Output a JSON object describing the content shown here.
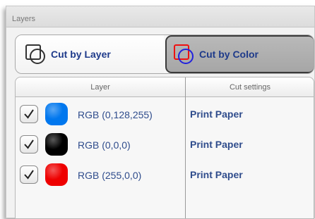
{
  "panel": {
    "title": "Layers"
  },
  "modes": {
    "cut_by_layer": "Cut by Layer",
    "cut_by_color": "Cut by Color",
    "selected": "Cut by Color"
  },
  "table": {
    "columns": [
      "Layer",
      "Cut settings"
    ],
    "rows": [
      {
        "checked": true,
        "color": "#0077ee",
        "color_label": "RGB (0,128,255)",
        "cut_setting": "Print Paper"
      },
      {
        "checked": true,
        "color": "#000000",
        "color_label": "RGB (0,0,0)",
        "cut_setting": "Print Paper"
      },
      {
        "checked": true,
        "color": "#ee0000",
        "color_label": "RGB (255,0,0)",
        "cut_setting": "Print Paper"
      }
    ]
  },
  "colors": {
    "text_accent": "#2f4c8c",
    "selected_tab": "#a6a6a6"
  }
}
